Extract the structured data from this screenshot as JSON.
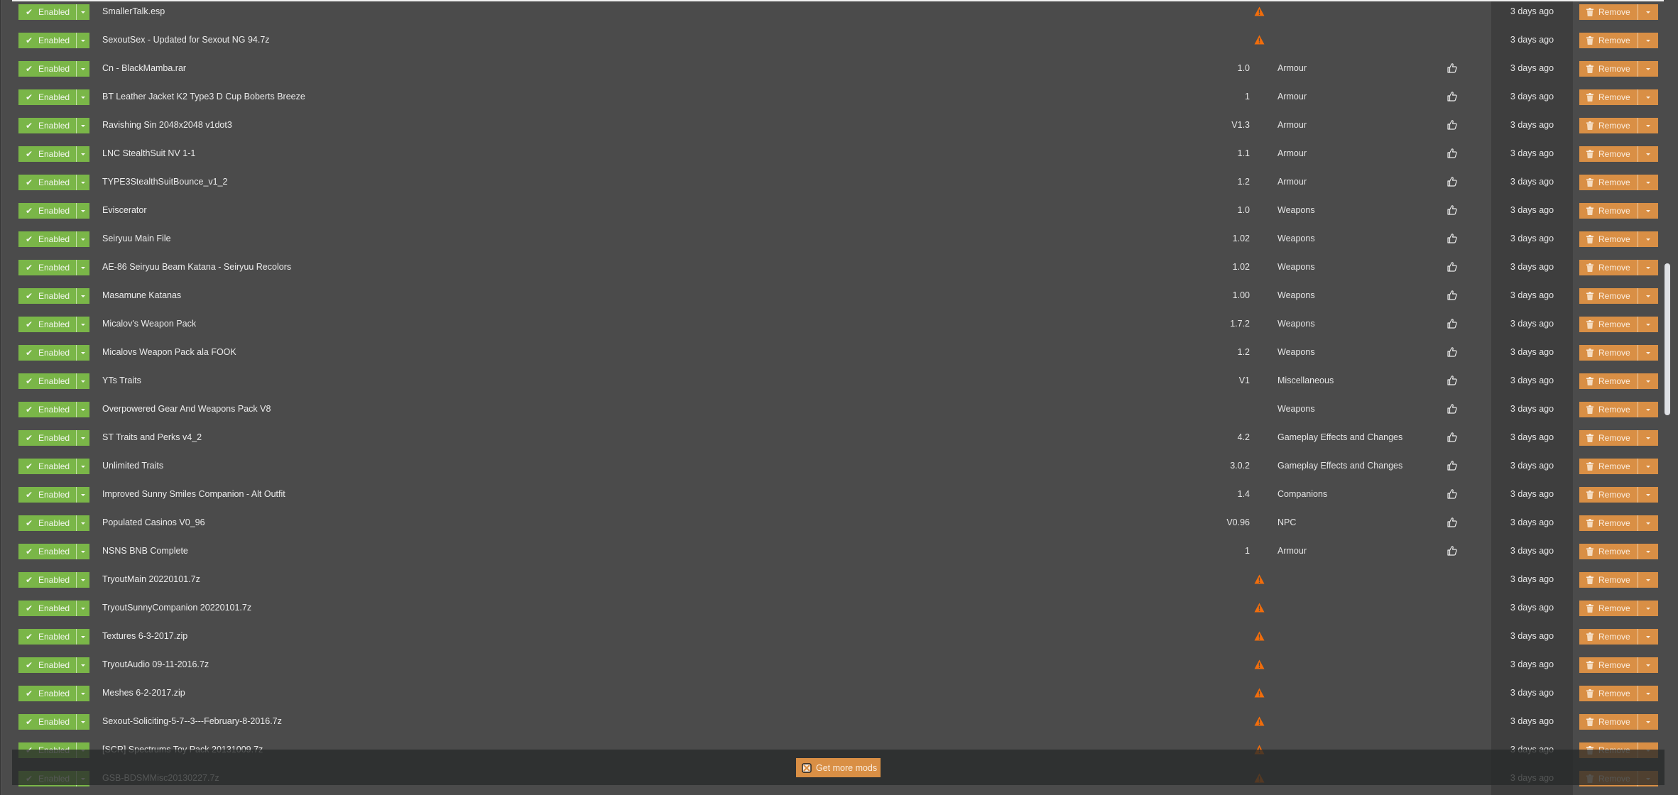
{
  "labels": {
    "enabled": "Enabled",
    "remove": "Remove",
    "get_more_mods": "Get more mods"
  },
  "colors": {
    "enabled_green": "#7ab648",
    "remove_orange": "#d98f45",
    "warning_orange": "#f26d0b",
    "background": "#4b4b4b",
    "date_column": "#3e3e3e"
  },
  "mods": [
    {
      "name": "SmallerTalk.esp",
      "version": "",
      "warning": true,
      "category": "",
      "endorse": false,
      "installed": "3 days ago"
    },
    {
      "name": "SexoutSex - Updated for Sexout NG 94.7z",
      "version": "",
      "warning": true,
      "category": "",
      "endorse": false,
      "installed": "3 days ago"
    },
    {
      "name": "Cn - BlackMamba.rar",
      "version": "1.0",
      "warning": false,
      "category": "Armour",
      "endorse": true,
      "installed": "3 days ago"
    },
    {
      "name": "BT Leather Jacket K2 Type3 D Cup Boberts Breeze",
      "version": "1",
      "warning": false,
      "category": "Armour",
      "endorse": true,
      "installed": "3 days ago"
    },
    {
      "name": "Ravishing Sin 2048x2048 v1dot3",
      "version": "V1.3",
      "warning": false,
      "category": "Armour",
      "endorse": true,
      "installed": "3 days ago"
    },
    {
      "name": "LNC StealthSuit NV 1-1",
      "version": "1.1",
      "warning": false,
      "category": "Armour",
      "endorse": true,
      "installed": "3 days ago"
    },
    {
      "name": "TYPE3StealthSuitBounce_v1_2",
      "version": "1.2",
      "warning": false,
      "category": "Armour",
      "endorse": true,
      "installed": "3 days ago"
    },
    {
      "name": "Eviscerator",
      "version": "1.0",
      "warning": false,
      "category": "Weapons",
      "endorse": true,
      "installed": "3 days ago"
    },
    {
      "name": "Seiryuu Main File",
      "version": "1.02",
      "warning": false,
      "category": "Weapons",
      "endorse": true,
      "installed": "3 days ago"
    },
    {
      "name": "AE-86 Seiryuu Beam Katana - Seiryuu Recolors",
      "version": "1.02",
      "warning": false,
      "category": "Weapons",
      "endorse": true,
      "installed": "3 days ago"
    },
    {
      "name": "Masamune Katanas",
      "version": "1.00",
      "warning": false,
      "category": "Weapons",
      "endorse": true,
      "installed": "3 days ago"
    },
    {
      "name": "Micalov's Weapon Pack",
      "version": "1.7.2",
      "warning": false,
      "category": "Weapons",
      "endorse": true,
      "installed": "3 days ago"
    },
    {
      "name": "Micalovs Weapon Pack ala FOOK",
      "version": "1.2",
      "warning": false,
      "category": "Weapons",
      "endorse": true,
      "installed": "3 days ago"
    },
    {
      "name": "YTs Traits",
      "version": "V1",
      "warning": false,
      "category": "Miscellaneous",
      "endorse": true,
      "installed": "3 days ago"
    },
    {
      "name": "Overpowered Gear And Weapons Pack V8",
      "version": "",
      "warning": false,
      "category": "Weapons",
      "endorse": true,
      "installed": "3 days ago"
    },
    {
      "name": "ST Traits and Perks v4_2",
      "version": "4.2",
      "warning": false,
      "category": "Gameplay Effects and Changes",
      "endorse": true,
      "installed": "3 days ago"
    },
    {
      "name": "Unlimited Traits",
      "version": "3.0.2",
      "warning": false,
      "category": "Gameplay Effects and Changes",
      "endorse": true,
      "installed": "3 days ago"
    },
    {
      "name": "Improved Sunny Smiles Companion - Alt Outfit",
      "version": "1.4",
      "warning": false,
      "category": "Companions",
      "endorse": true,
      "installed": "3 days ago"
    },
    {
      "name": "Populated Casinos V0_96",
      "version": "V0.96",
      "warning": false,
      "category": "NPC",
      "endorse": true,
      "installed": "3 days ago"
    },
    {
      "name": "NSNS BNB Complete",
      "version": "1",
      "warning": false,
      "category": "Armour",
      "endorse": true,
      "installed": "3 days ago"
    },
    {
      "name": "TryoutMain 20220101.7z",
      "version": "",
      "warning": true,
      "category": "",
      "endorse": false,
      "installed": "3 days ago"
    },
    {
      "name": "TryoutSunnyCompanion 20220101.7z",
      "version": "",
      "warning": true,
      "category": "",
      "endorse": false,
      "installed": "3 days ago"
    },
    {
      "name": "Textures 6-3-2017.zip",
      "version": "",
      "warning": true,
      "category": "",
      "endorse": false,
      "installed": "3 days ago"
    },
    {
      "name": "TryoutAudio 09-11-2016.7z",
      "version": "",
      "warning": true,
      "category": "",
      "endorse": false,
      "installed": "3 days ago"
    },
    {
      "name": "Meshes 6-2-2017.zip",
      "version": "",
      "warning": true,
      "category": "",
      "endorse": false,
      "installed": "3 days ago"
    },
    {
      "name": "Sexout-Soliciting-5-7--3---February-8-2016.7z",
      "version": "",
      "warning": true,
      "category": "",
      "endorse": false,
      "installed": "3 days ago"
    },
    {
      "name": "[SCR] Spectrums Toy Pack 20131009.7z",
      "version": "",
      "warning": true,
      "category": "",
      "endorse": false,
      "installed": "3 days ago"
    },
    {
      "name": "GSB-BDSMMisc20130227.7z",
      "version": "",
      "warning": true,
      "category": "",
      "endorse": false,
      "installed": "3 days ago"
    }
  ]
}
